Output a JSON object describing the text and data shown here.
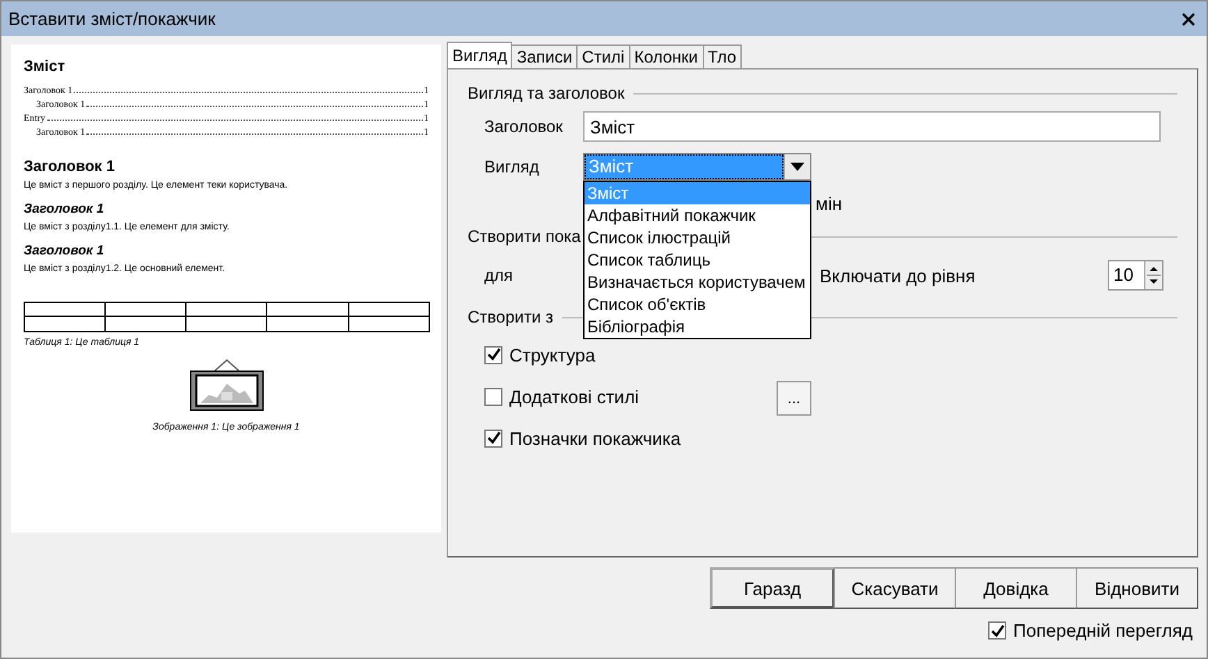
{
  "window": {
    "title": "Вставити зміст/покажчик"
  },
  "preview": {
    "toc_title": "Зміст",
    "toc": [
      {
        "text": "Заголовок 1",
        "page": "1",
        "children": [
          {
            "text": "Заголовок 1",
            "page": "1"
          }
        ]
      },
      {
        "text": "Entry",
        "page": "1",
        "children": [
          {
            "text": "Заголовок 1",
            "page": "1"
          }
        ]
      }
    ],
    "blocks": [
      {
        "kind": "heading1",
        "text": "Заголовок 1"
      },
      {
        "kind": "paragraph",
        "text": "Це вміст з першого розділу. Це елемент теки користувача."
      },
      {
        "kind": "heading2",
        "text": "Заголовок 1"
      },
      {
        "kind": "paragraph",
        "text": "Це вміст з розділу1.1. Це елемент для змісту."
      },
      {
        "kind": "heading2",
        "text": "Заголовок 1"
      },
      {
        "kind": "paragraph",
        "text": "Це вміст з розділу1.2. Це основний елемент."
      }
    ],
    "table_caption": "Таблиця 1: Це таблиця 1",
    "image_caption": "Зображення 1: Це зображення 1"
  },
  "tabs": [
    {
      "label": "Вигляд",
      "selected": true
    },
    {
      "label": "Записи",
      "selected": false
    },
    {
      "label": "Стилі",
      "selected": false
    },
    {
      "label": "Колонки",
      "selected": false
    },
    {
      "label": "Тло",
      "selected": false
    }
  ],
  "type_section": {
    "title": "Вигляд та заголовок",
    "title_field": {
      "label": "Заголовок",
      "value": "Зміст"
    },
    "type_combo": {
      "label": "Вигляд",
      "value": "Зміст"
    },
    "dropdown": [
      {
        "label": "Зміст",
        "selected": true
      },
      {
        "label": "Алфавітний покажчик",
        "selected": false
      },
      {
        "label": "Список ілюстрацій",
        "selected": false
      },
      {
        "label": "Список таблиць",
        "selected": false
      },
      {
        "label": "Визначається користувачем",
        "selected": false
      },
      {
        "label": "Список об'єктів",
        "selected": false
      },
      {
        "label": "Бібліографія",
        "selected": false
      }
    ],
    "covered_text": "мін"
  },
  "create_index": {
    "title": "Створити пока",
    "for_label": "для",
    "level_label": "Включати до рівня",
    "level_value": "10"
  },
  "create_from": {
    "title": "Створити з",
    "checks": [
      {
        "label": "Структура",
        "checked": true
      },
      {
        "label": "Додаткові стилі",
        "checked": false,
        "more_button": "..."
      },
      {
        "label": "Позначки покажчика",
        "checked": true
      }
    ]
  },
  "buttons": [
    {
      "label": "Гаразд",
      "default": true
    },
    {
      "label": "Скасувати",
      "default": false
    },
    {
      "label": "Довідка",
      "default": false
    },
    {
      "label": "Відновити",
      "default": false
    }
  ],
  "preview_check": {
    "label": "Попередній перегляд",
    "checked": true
  }
}
